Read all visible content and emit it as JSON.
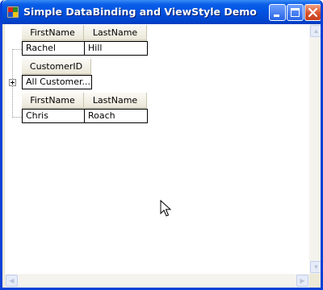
{
  "window": {
    "title": "Simple DataBinding and ViewStyle Demo"
  },
  "icons": {
    "app": "app-icon",
    "minimize": "minimize-icon",
    "maximize": "maximize-icon",
    "close": "close-icon"
  },
  "grid1": {
    "columns": [
      "FirstName",
      "LastName"
    ],
    "rows": [
      [
        "Rachel",
        "Hill"
      ]
    ]
  },
  "grid2": {
    "columns": [
      "CustomerID"
    ],
    "rows": [
      [
        "All Customer..."
      ]
    ]
  },
  "grid3": {
    "columns": [
      "FirstName",
      "LastName"
    ],
    "rows": [
      [
        "Chris",
        "Roach"
      ]
    ]
  },
  "colors": {
    "titlebar": "#0054e3",
    "window_border": "#0841d6",
    "close_button": "#d9512c"
  }
}
